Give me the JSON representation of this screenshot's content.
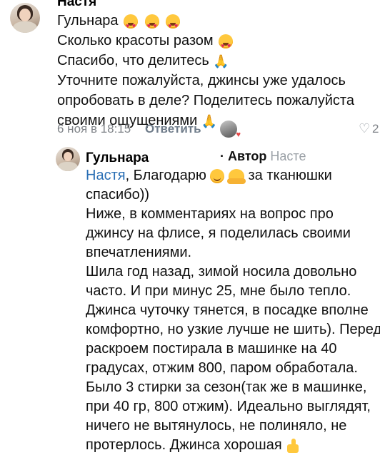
{
  "top_comment": {
    "author_partial": "Настя",
    "author": "Гульнара",
    "lines": [
      "Сколько красоты разом",
      "Спасибо, что делитесь",
      "Уточните пожалуйста, джинсы уже удалось",
      "опробовать в деле? Поделитесь пожалуйста",
      "своими ощущениями"
    ],
    "date": "6 ноя в 18:15",
    "reply_label": "Ответить",
    "likes_partial": "2"
  },
  "reply": {
    "author": "Гульнара",
    "author_badge": "· Автор",
    "reply_to": "Насте",
    "mention": "Настя",
    "line1_a": ", Благодарю",
    "line1_b": " за тканюшки",
    "lines": [
      "спасибо))",
      "Ниже, в комментариях на вопрос про",
      "джинсу на флисе, я поделилась своими",
      "впечатлениями.",
      "Шила год назад,  зимой носила довольно",
      "часто. И при минус 25, мне было тепло.",
      "Джинса чуточку  тянется, в посадке  вполне",
      "комфортно, но узкие лучше не шить). Перед",
      "раскроем постирала в машинке на 40",
      "градусах, отжим 800, паром обработала.",
      "Было 3 стирки за сезон(так же в машинке,",
      "при 40 гр, 800 отжим). Идеально выглядят,",
      "ничего не вытянулось, не полиняло,  не",
      "протерлось. Джинса хорошая"
    ]
  },
  "icons": [
    "avatar",
    "heart-eyes-emoji",
    "folded-hands-emoji",
    "smile-emoji",
    "hug-emoji",
    "thumbs-up-emoji",
    "like-heart-icon"
  ]
}
